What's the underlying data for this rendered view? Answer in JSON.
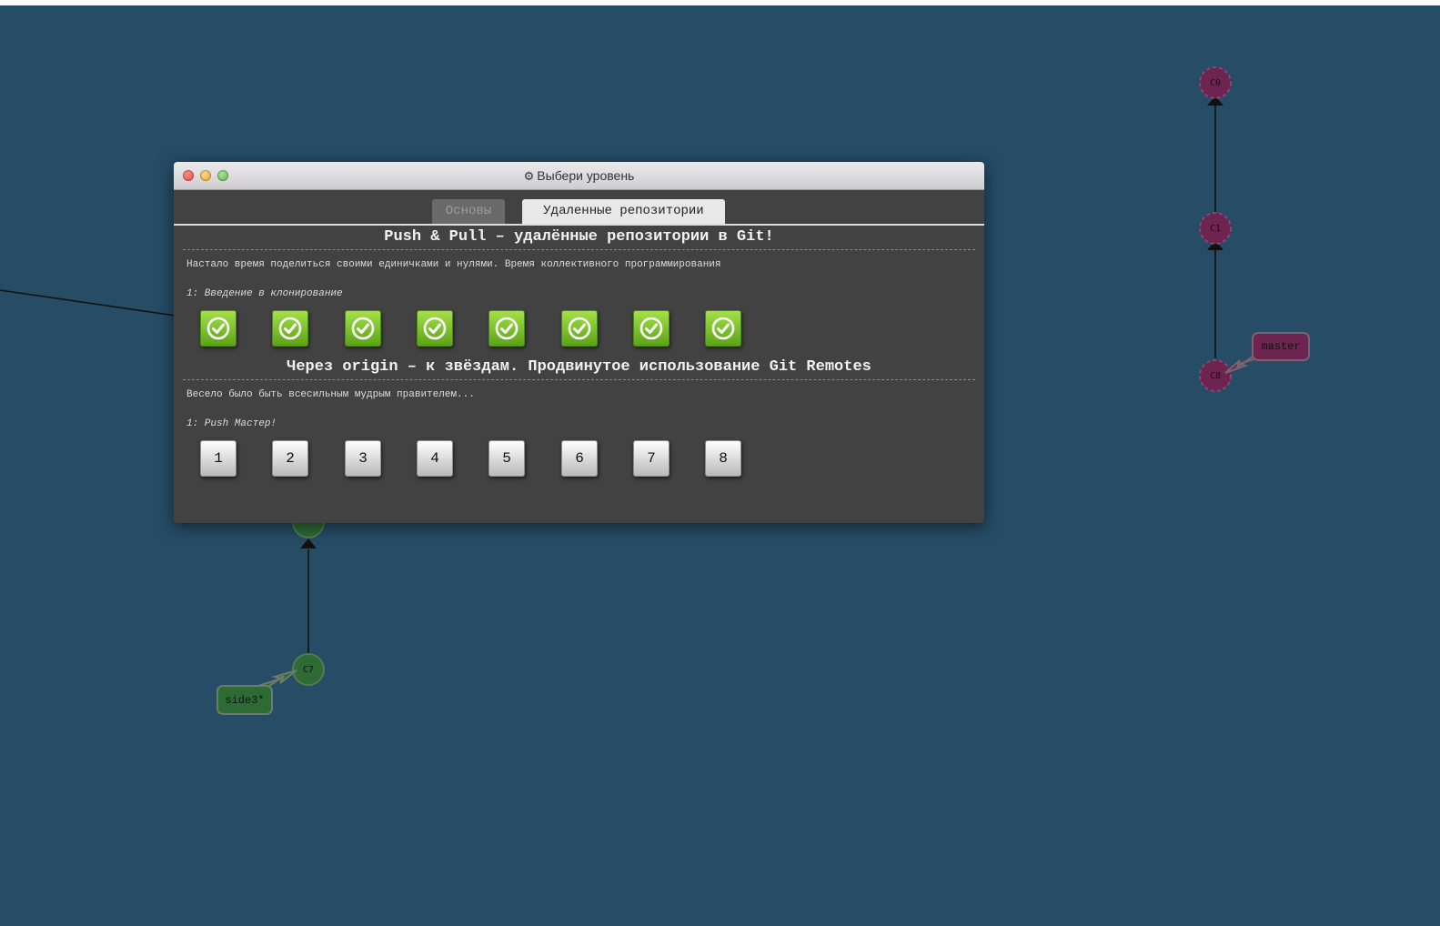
{
  "graph": {
    "commits": {
      "c0": "C0",
      "c1": "C1",
      "c8": "C8",
      "c7": "C7"
    },
    "branches": {
      "master": "master",
      "side3": "side3*"
    },
    "colors": {
      "background": "#264c66",
      "master_branch": "#6e2450",
      "side3_branch": "#2e6b34"
    }
  },
  "modal": {
    "title": "Выбери уровень",
    "title_icon": "gear-icon",
    "tabs": {
      "basics": "Основы",
      "remote": "Удаленные репозитории"
    },
    "sections": [
      {
        "title": "Push & Pull – удалённые репозитории в Git!",
        "description": "Настало время поделиться своими единичками и нулями. Время коллективного программирования",
        "subtitle": "1: Введение в клонирование",
        "levels_completed": [
          true,
          true,
          true,
          true,
          true,
          true,
          true,
          true
        ]
      },
      {
        "title": "Через origin – к звёздам. Продвинутое использование Git Remotes",
        "description": "Весело было быть всесильным мудрым правителем...",
        "subtitle": "1: Push Мастер!",
        "levels": [
          "1",
          "2",
          "3",
          "4",
          "5",
          "6",
          "7",
          "8"
        ]
      }
    ],
    "colors": {
      "completed": "#7ac52a",
      "panel": "#424242"
    }
  }
}
